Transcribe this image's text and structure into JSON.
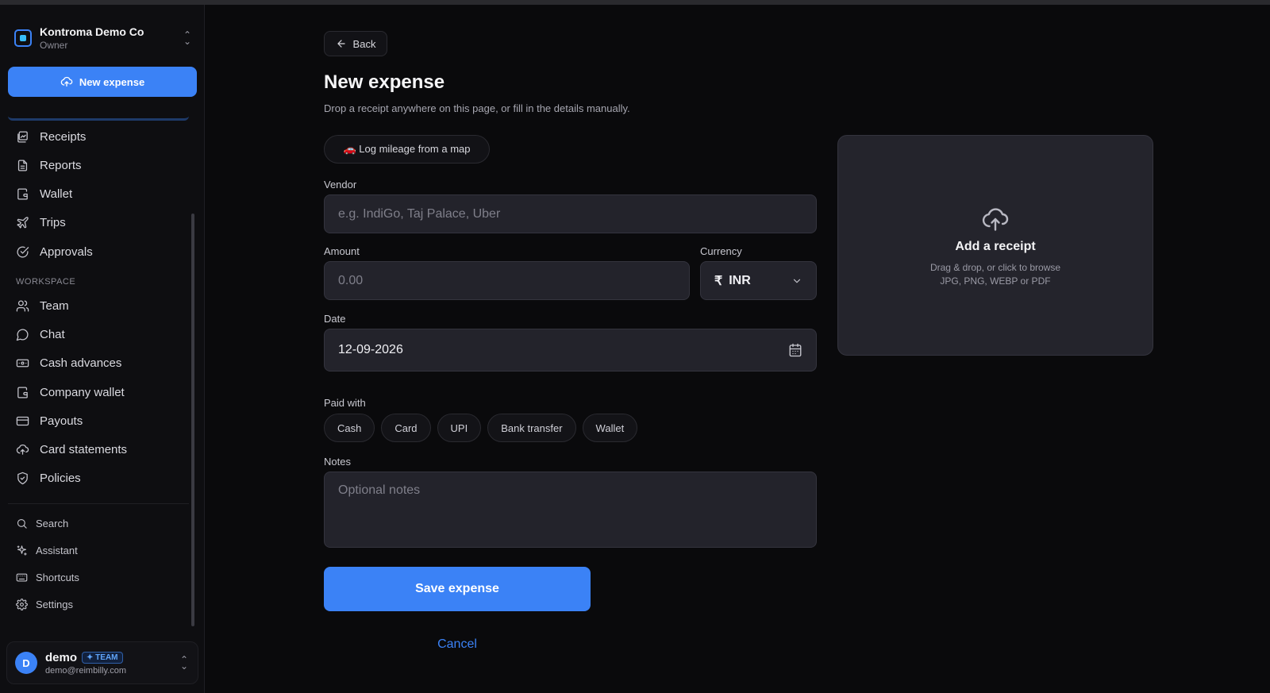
{
  "org": {
    "name": "Kontroma Demo Co",
    "role": "Owner"
  },
  "sidebar": {
    "new_expense_label": "New expense",
    "items": [
      {
        "label": "Receipts",
        "icon": "receipt-icon"
      },
      {
        "label": "Reports",
        "icon": "report-icon"
      },
      {
        "label": "Wallet",
        "icon": "wallet-icon"
      },
      {
        "label": "Trips",
        "icon": "plane-icon"
      },
      {
        "label": "Approvals",
        "icon": "check-circle-icon"
      }
    ],
    "workspace_label": "WORKSPACE",
    "workspace_items": [
      {
        "label": "Team",
        "icon": "users-icon"
      },
      {
        "label": "Chat",
        "icon": "chat-icon"
      },
      {
        "label": "Cash advances",
        "icon": "cash-icon"
      },
      {
        "label": "Company wallet",
        "icon": "wallet-icon"
      },
      {
        "label": "Payouts",
        "icon": "card-icon"
      },
      {
        "label": "Card statements",
        "icon": "upload-cloud-icon"
      },
      {
        "label": "Policies",
        "icon": "shield-icon"
      }
    ],
    "utility_items": [
      {
        "label": "Search",
        "icon": "search-icon"
      },
      {
        "label": "Assistant",
        "icon": "sparkle-icon"
      },
      {
        "label": "Shortcuts",
        "icon": "keyboard-icon"
      },
      {
        "label": "Settings",
        "icon": "gear-icon"
      }
    ]
  },
  "user": {
    "initial": "D",
    "name": "demo",
    "badge": "✦ TEAM",
    "email": "demo@reimbilly.com"
  },
  "page": {
    "back_label": "Back",
    "title": "New expense",
    "subtitle": "Drop a receipt anywhere on this page, or fill in the details manually.",
    "mileage_label": "🚗 Log mileage from a map"
  },
  "form": {
    "vendor_label": "Vendor",
    "vendor_placeholder": "e.g. IndiGo, Taj Palace, Uber",
    "amount_label": "Amount",
    "amount_placeholder": "0.00",
    "currency_label": "Currency",
    "currency_symbol": "₹",
    "currency_value": "INR",
    "date_label": "Date",
    "date_value": "12-09-2026",
    "paid_with_label": "Paid with",
    "paid_with_options": [
      "Cash",
      "Card",
      "UPI",
      "Bank transfer",
      "Wallet"
    ],
    "notes_label": "Notes",
    "notes_placeholder": "Optional notes",
    "save_label": "Save expense",
    "cancel_label": "Cancel"
  },
  "receipt": {
    "title": "Add a receipt",
    "hint": "Drag & drop, or click to browse",
    "types": "JPG, PNG, WEBP or PDF"
  },
  "colors": {
    "accent": "#3b82f6",
    "background": "#0a0a0c",
    "input": "#23232b"
  }
}
